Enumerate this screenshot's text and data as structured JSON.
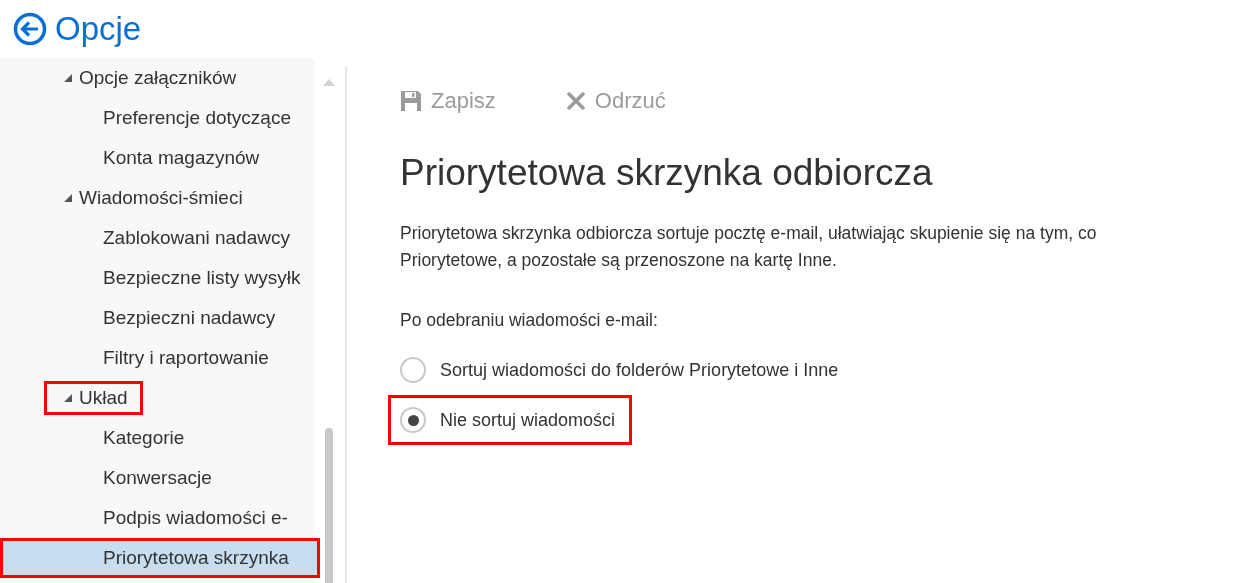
{
  "header": {
    "title": "Opcje"
  },
  "sidebar": {
    "items": [
      {
        "label": "Opcje załączników",
        "expanded": true,
        "highlighted": false,
        "children": [
          {
            "label": "Preferencje dotyczące",
            "selected": false,
            "highlighted": false
          },
          {
            "label": "Konta magazynów",
            "selected": false,
            "highlighted": false
          }
        ]
      },
      {
        "label": "Wiadomości-śmieci",
        "expanded": true,
        "highlighted": false,
        "children": [
          {
            "label": "Zablokowani nadawcy",
            "selected": false,
            "highlighted": false
          },
          {
            "label": "Bezpieczne listy wysyłk",
            "selected": false,
            "highlighted": false
          },
          {
            "label": "Bezpieczni nadawcy",
            "selected": false,
            "highlighted": false
          },
          {
            "label": "Filtry i raportowanie",
            "selected": false,
            "highlighted": false
          }
        ]
      },
      {
        "label": "Układ",
        "expanded": true,
        "highlighted": true,
        "children": [
          {
            "label": "Kategorie",
            "selected": false,
            "highlighted": false
          },
          {
            "label": "Konwersacje",
            "selected": false,
            "highlighted": false
          },
          {
            "label": "Podpis wiadomości e-",
            "selected": false,
            "highlighted": false
          },
          {
            "label": "Priorytetowa skrzynka",
            "selected": true,
            "highlighted": true
          }
        ]
      }
    ]
  },
  "toolbar": {
    "buttons": [
      {
        "kind": "save",
        "label": "Zapisz",
        "disabled": true
      },
      {
        "kind": "discard",
        "label": "Odrzuć",
        "disabled": true
      }
    ]
  },
  "content": {
    "title": "Priorytetowa skrzynka odbiorcza",
    "description_lines": [
      "Priorytetowa skrzynka odbiorcza sortuje pocztę e-mail, ułatwiając skupienie się na tym, co",
      "Priorytetowe, a pozostałe są przenoszone na kartę Inne."
    ],
    "prompt": "Po odebraniu wiadomości e-mail:",
    "options": [
      {
        "label": "Sortuj wiadomości do folderów Priorytetowe i Inne",
        "selected": false,
        "highlighted": false
      },
      {
        "label": "Nie sortuj wiadomości",
        "selected": true,
        "highlighted": true
      }
    ]
  }
}
